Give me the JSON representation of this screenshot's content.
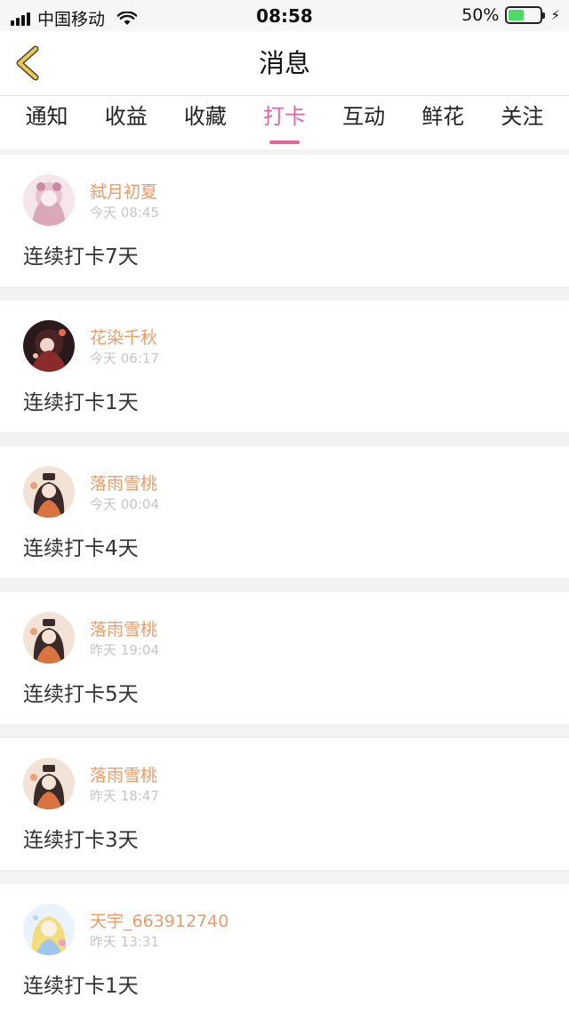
{
  "statusbar": {
    "carrier": "中国移动",
    "time": "08:58",
    "battery": "50%",
    "battery_level": 0.5
  },
  "navbar": {
    "title": "消息"
  },
  "tabs": [
    {
      "label": "通知",
      "active": false
    },
    {
      "label": "收益",
      "active": false
    },
    {
      "label": "收藏",
      "active": false
    },
    {
      "label": "打卡",
      "active": true
    },
    {
      "label": "互动",
      "active": false
    },
    {
      "label": "鲜花",
      "active": false
    },
    {
      "label": "关注",
      "active": false
    }
  ],
  "items": [
    {
      "name": "弑月初夏",
      "time": "今天 08:45",
      "message": "连续打卡7天",
      "avatar": "anime-girl-pink"
    },
    {
      "name": "花染千秋",
      "time": "今天 06:17",
      "message": "连续打卡1天",
      "avatar": "anime-girl-dark"
    },
    {
      "name": "落雨雪桃",
      "time": "今天 00:04",
      "message": "连续打卡4天",
      "avatar": "anime-girl-orange"
    },
    {
      "name": "落雨雪桃",
      "time": "昨天 19:04",
      "message": "连续打卡5天",
      "avatar": "anime-girl-orange"
    },
    {
      "name": "落雨雪桃",
      "time": "昨天 18:47",
      "message": "连续打卡3天",
      "avatar": "anime-girl-orange"
    },
    {
      "name": "天宇_663912740",
      "time": "昨天 13:31",
      "message": "连续打卡1天",
      "avatar": "anime-girl-yellow"
    }
  ],
  "colors": {
    "accent": "#e8659a",
    "name": "#e59d6b",
    "time": "#c6c6c6",
    "back_arrow": "#f2c94c"
  }
}
